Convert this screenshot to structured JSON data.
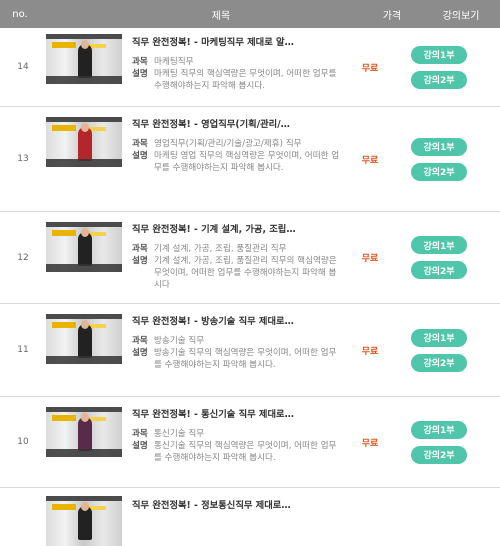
{
  "header": {
    "no": "no.",
    "title": "제목",
    "price": "가격",
    "view": "강의보기"
  },
  "rows": [
    {
      "no": "14",
      "title": "직무 완전정복! - 마케팅직무 제대로 알…",
      "course_label": "과목",
      "course": "마케팅직무",
      "desc_label": "설명",
      "desc": "마케팅 직무의 핵심역량은 무엇이며, 어떠한 업무를 수행해야하는지 파악해 봅시다.",
      "price": "무료",
      "btn1": "강의1부",
      "btn2": "강의2부"
    },
    {
      "no": "13",
      "title": "직무 완전정복! - 영업직무(기획/관리/…",
      "course_label": "과목",
      "course": "영업직무(기획/관리/기술/광고/제휴) 직무",
      "desc_label": "설명",
      "desc": "마케팅 영업 직무의 핵심역량은 무엇이며, 어떠한 업무를 수행해야하는지 파악해 봅시다.",
      "price": "무료",
      "btn1": "강의1부",
      "btn2": "강의2부"
    },
    {
      "no": "12",
      "title": "직무 완전정복! - 기계 설계, 가공, 조립…",
      "course_label": "과목",
      "course": "기계 설계, 가공, 조립, 품질관리 직무",
      "desc_label": "설명",
      "desc": "기계 설계, 가공, 조립, 품질관리 직무의 핵심역량은 무엇이며, 어떠한 업무를 수행해야하는지 파악해 봅시다",
      "price": "무료",
      "btn1": "강의1부",
      "btn2": "강의2부"
    },
    {
      "no": "11",
      "title": "직무 완전정복! - 방송기술 직무 제대로…",
      "course_label": "과목",
      "course": "방송기술 직무",
      "desc_label": "설명",
      "desc": "방송기술 직무의 핵심역량은 무엇이며, 어떠한 업무를 수행해야하는지 파악해 봅시다.",
      "price": "무료",
      "btn1": "강의1부",
      "btn2": "강의2부"
    },
    {
      "no": "10",
      "title": "직무 완전정복! - 통신기술 직무 제대로…",
      "course_label": "과목",
      "course": "통신기술 직무",
      "desc_label": "설명",
      "desc": "통신기술 직무의 핵심역량은 무엇이며, 어떠한 업무를 수행해야하는지 파악해 봅시다.",
      "price": "무료",
      "btn1": "강의1부",
      "btn2": "강의2부"
    },
    {
      "no": "",
      "title": "직무 완전정복! - 정보통신직무 제대로…"
    }
  ],
  "colors": {
    "header_bg": "#8c8c8c",
    "price": "#e0561e",
    "button": "#4fc5a9"
  }
}
